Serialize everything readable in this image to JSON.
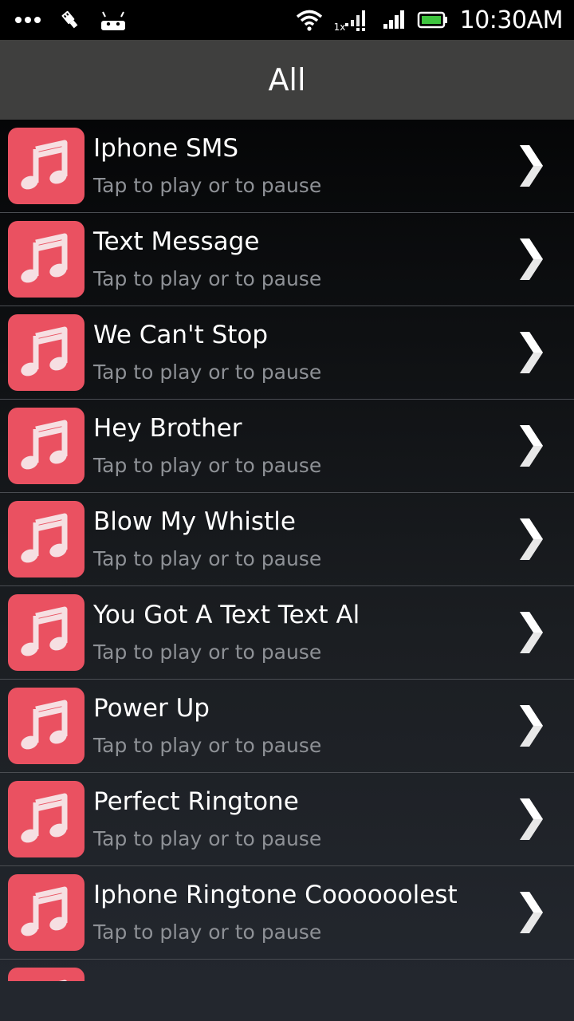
{
  "status_bar": {
    "time": "10:30AM",
    "network_label": "1x",
    "icons": [
      "more-dots-icon",
      "usb-debug-icon",
      "android-icon",
      "wifi-icon",
      "data-signal-icon",
      "cell-signal-icon",
      "battery-icon"
    ]
  },
  "header": {
    "title": "All"
  },
  "list": {
    "items": [
      {
        "title": "Iphone SMS",
        "subtitle": "Tap to play or to pause"
      },
      {
        "title": "Text Message",
        "subtitle": "Tap to play or to pause"
      },
      {
        "title": "We Can't Stop",
        "subtitle": "Tap to play or to pause"
      },
      {
        "title": "Hey Brother",
        "subtitle": "Tap to play or to pause"
      },
      {
        "title": "Blow My Whistle",
        "subtitle": "Tap to play or to pause"
      },
      {
        "title": "You Got A Text Text Al",
        "subtitle": "Tap to play or to pause"
      },
      {
        "title": "Power Up",
        "subtitle": "Tap to play or to pause"
      },
      {
        "title": "Perfect Ringtone",
        "subtitle": "Tap to play or to pause"
      },
      {
        "title": "Iphone Ringtone Coooooolest",
        "subtitle": "Tap to play or to pause"
      }
    ]
  },
  "colors": {
    "icon_bg": "#ea5161",
    "header_bg": "#3f3f3e",
    "subtitle": "#8e9196"
  }
}
